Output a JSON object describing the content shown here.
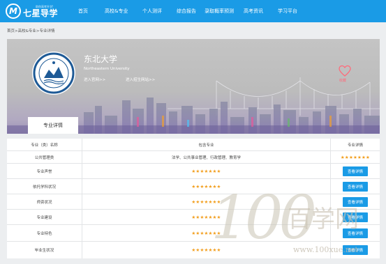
{
  "logo": {
    "tagline": "助你高考升学!",
    "name": "七星导学",
    "mark": "M"
  },
  "nav": {
    "items": [
      {
        "label": "首页"
      },
      {
        "label": "高校&专业"
      },
      {
        "label": "个人测评"
      },
      {
        "label": "综合报告"
      },
      {
        "label": "录取概率预测"
      },
      {
        "label": "高考资讯"
      },
      {
        "label": "学习平台"
      }
    ]
  },
  "breadcrumb": "首页>高校&专业>专业详情",
  "banner": {
    "name_cn": "东北大学",
    "name_en": "Northeastern University",
    "link_official": "进入官网>>",
    "link_admission": "进入招生网站>>",
    "favorite_label": "收藏",
    "tab_label": "专业详情"
  },
  "table": {
    "headers": [
      "专业（类）名称",
      "包含专业",
      "专业详情"
    ],
    "rows": [
      {
        "name": "公共管理类",
        "content": "法学、公共事业管理、行政管理、教育学",
        "type": "text",
        "detail": "★★★★★★★"
      },
      {
        "name": "专业声誉",
        "content": "★★★★★★★",
        "type": "stars",
        "detail": "查看详情"
      },
      {
        "name": "依托学科状况",
        "content": "★★★★★★★",
        "type": "stars",
        "detail": "查看详情"
      },
      {
        "name": "师资状况",
        "content": "★★★★★★★",
        "type": "stars",
        "detail": "查看详情"
      },
      {
        "name": "专业建设",
        "content": "★★★★★★★",
        "type": "stars",
        "detail": "查看详情"
      },
      {
        "name": "专业特色",
        "content": "★★★★★★★",
        "type": "stars",
        "detail": "查看详情"
      },
      {
        "name": "毕业生状况",
        "content": "★★★★★★★",
        "type": "stars",
        "detail": "查看详情"
      }
    ]
  },
  "watermark": {
    "digits": "100",
    "cn": "百学网",
    "url": "www.100xue.net"
  },
  "colors": {
    "nav_bg": "#1a9be6",
    "star": "#f29d1a",
    "button": "#1a9be6",
    "heart": "#ff6a7a"
  }
}
